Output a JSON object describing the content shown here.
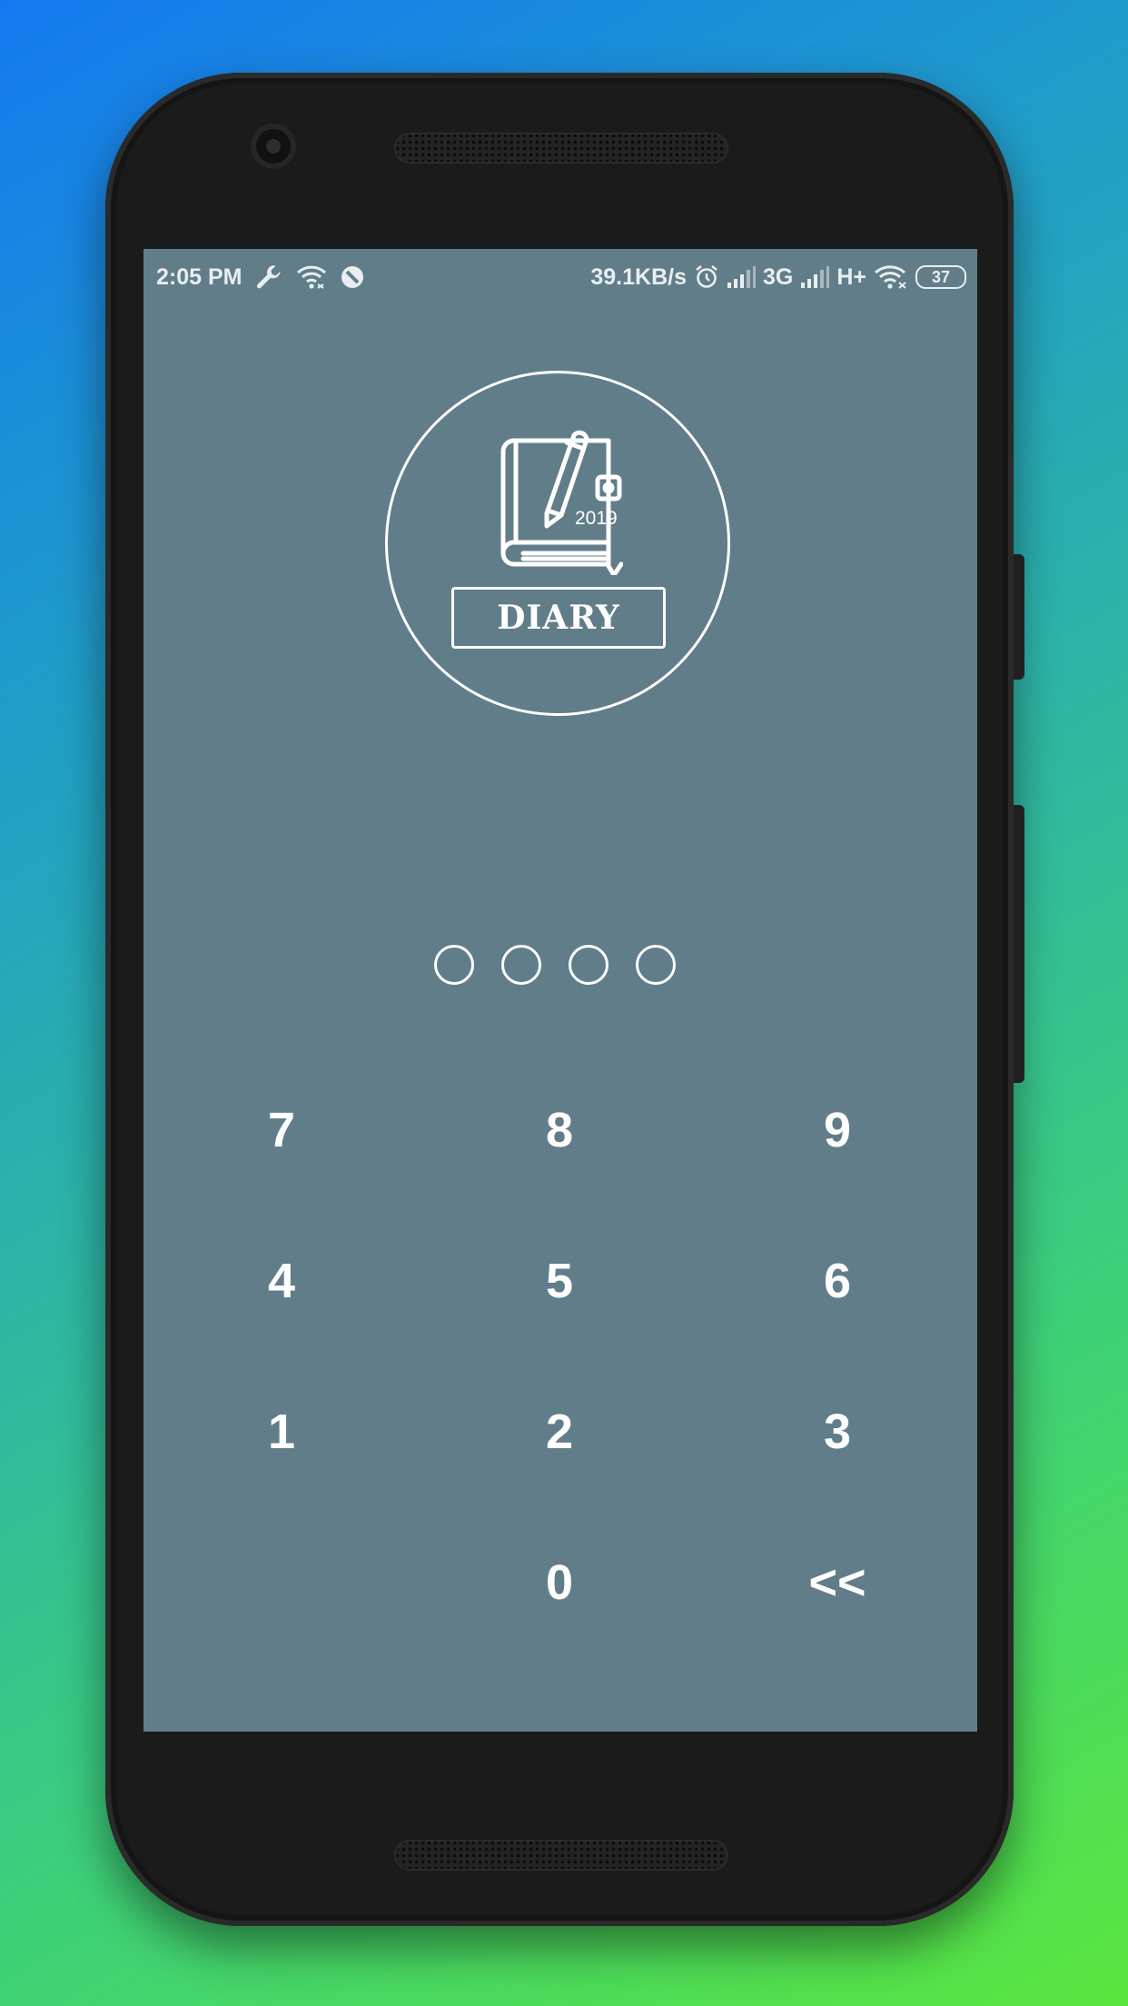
{
  "status_bar": {
    "time": "2:05 PM",
    "network_speed": "39.1KB/s",
    "network_3g": "3G",
    "network_hplus": "H+",
    "battery": "37",
    "icons": [
      "wrench-icon",
      "wifi-hotspot-icon",
      "do-not-disturb-icon",
      "alarm-icon",
      "signal-icon",
      "signal-icon",
      "wifi-icon",
      "battery-icon"
    ]
  },
  "logo": {
    "icon": "diary-book-pencil-icon",
    "year": "2019",
    "label": "DIARY"
  },
  "pin": {
    "length": 4,
    "filled": 0
  },
  "keypad": {
    "keys": [
      "7",
      "8",
      "9",
      "4",
      "5",
      "6",
      "1",
      "2",
      "3",
      "0"
    ],
    "backspace": "<<"
  },
  "colors": {
    "screen_background": "#617d8a",
    "foreground": "#ffffff"
  }
}
